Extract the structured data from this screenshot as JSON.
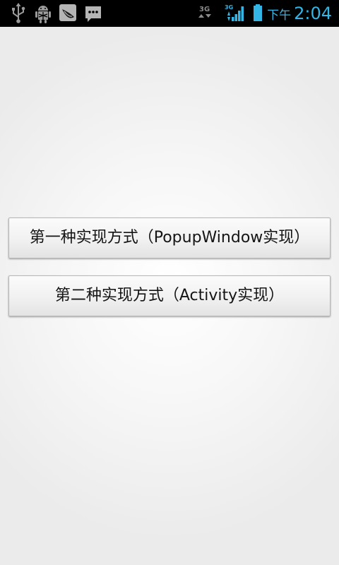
{
  "status_bar": {
    "icons": [
      "usb-icon",
      "android-debug-icon",
      "app-notification-icon",
      "message-icon",
      "3g-data-icon",
      "signal-icon",
      "battery-icon"
    ],
    "network_label": "3G",
    "ampm": "下午",
    "time": "2:04",
    "accent_color": "#33b5e5"
  },
  "main": {
    "buttons": [
      {
        "label": "第一种实现方式（PopupWindow实现）"
      },
      {
        "label": "第二种实现方式（Activity实现）"
      }
    ]
  }
}
